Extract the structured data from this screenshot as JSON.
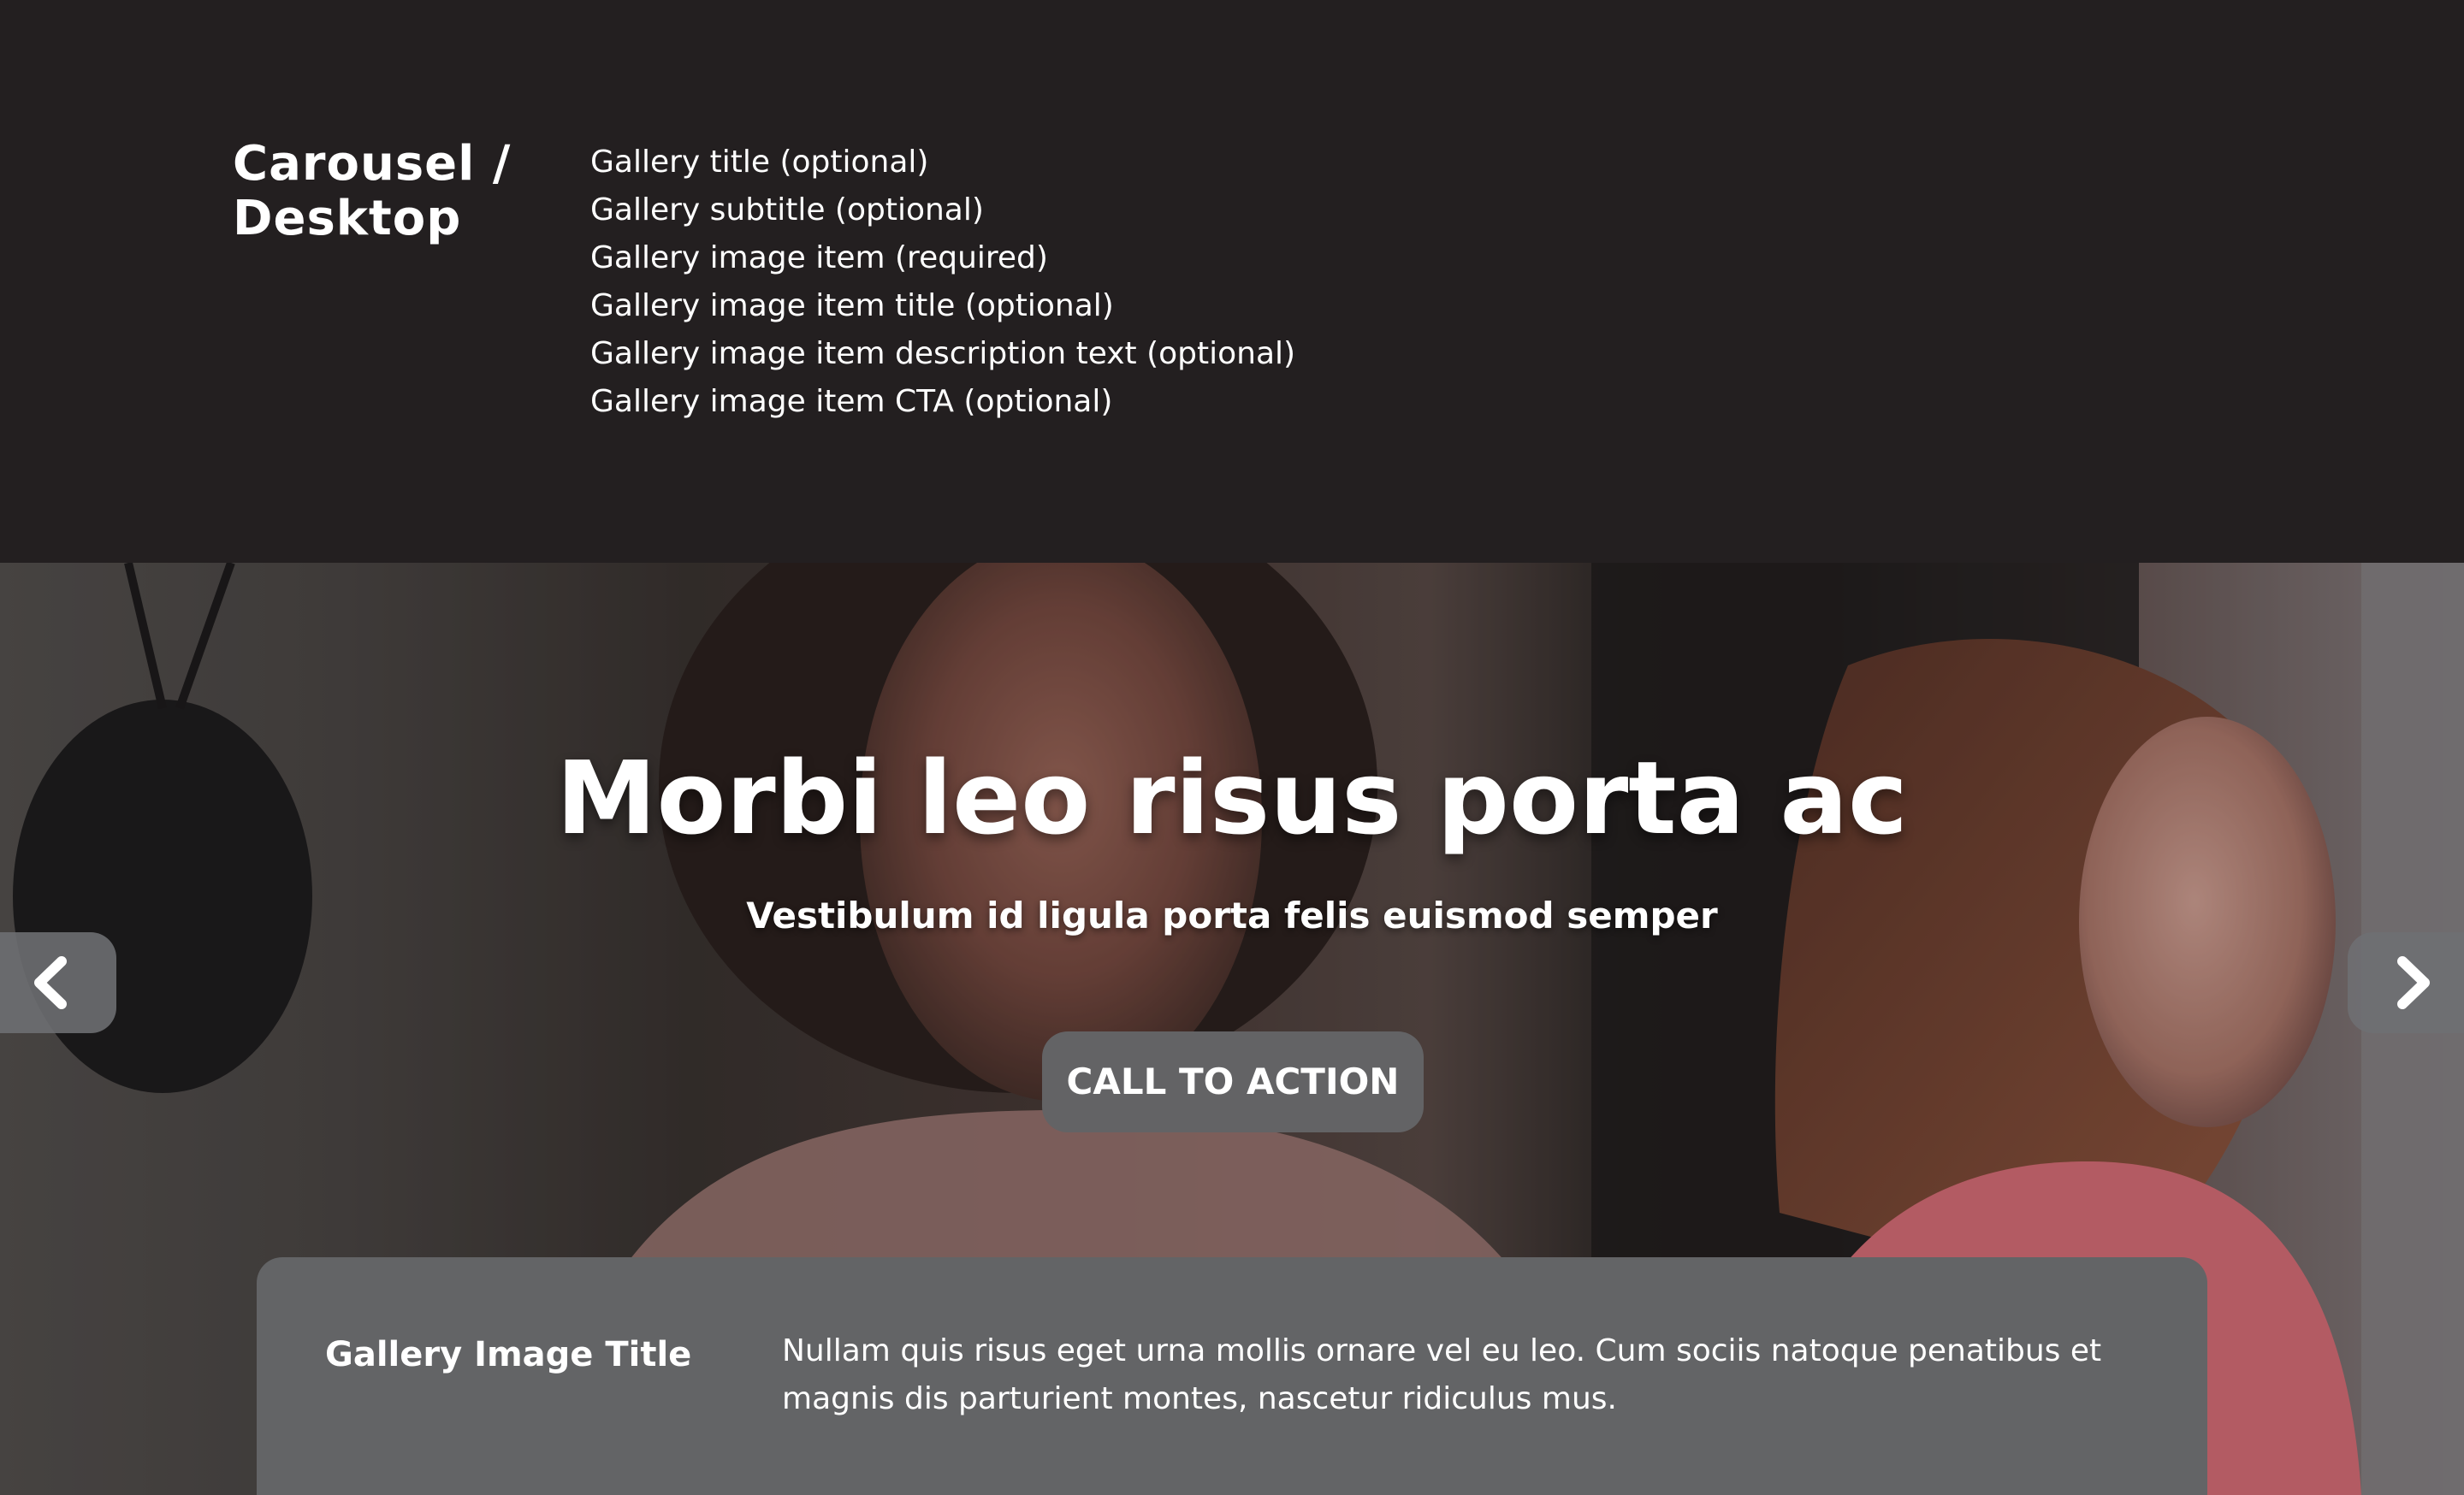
{
  "spec": {
    "title": "Carousel / Desktop",
    "items": [
      "Gallery title (optional)",
      "Gallery subtitle (optional)",
      "Gallery image item (required)",
      "Gallery image item title (optional)",
      "Gallery image item description text (optional)",
      "Gallery image item CTA (optional)"
    ]
  },
  "hero": {
    "title": "Morbi leo risus porta ac",
    "subtitle": "Vestibulum id ligula porta felis euismod semper",
    "cta_label": "CALL TO ACTION",
    "prev_icon": "chevron-left-icon",
    "next_icon": "chevron-right-icon"
  },
  "caption": {
    "title": "Gallery Image Title",
    "text": "Nullam quis risus eget urna mollis ornare vel eu leo. Cum sociis natoque penatibus et magnis dis parturient montes, nascetur ridiculus mus."
  },
  "colors": {
    "background": "#231f20",
    "panel": "#636466",
    "button": "#636365",
    "text": "#ffffff"
  }
}
